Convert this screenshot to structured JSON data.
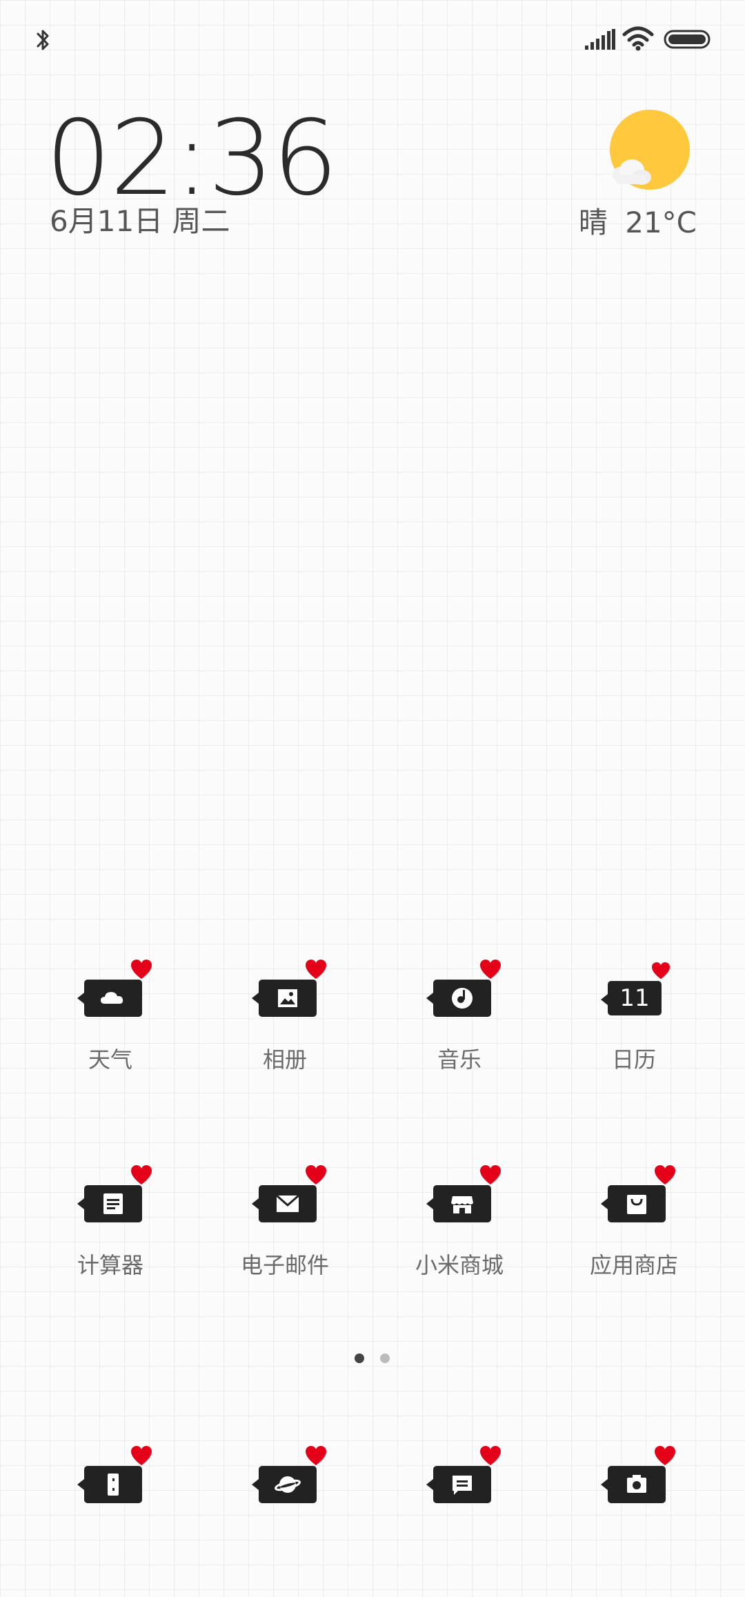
{
  "status_bar": {
    "bluetooth_icon": "bluetooth-icon",
    "signal_icon": "signal-icon",
    "wifi_icon": "wifi-icon",
    "battery_icon": "battery-icon"
  },
  "clock": {
    "time": "02:36",
    "date": "6月11日 周二"
  },
  "weather": {
    "condition": "晴",
    "temperature": "21°C",
    "icon": "sun-cloud-icon",
    "sun_color": "#FFC83D"
  },
  "apps": [
    {
      "label": "天气",
      "icon": "cloud-icon"
    },
    {
      "label": "相册",
      "icon": "image-icon"
    },
    {
      "label": "音乐",
      "icon": "music-disc-icon"
    },
    {
      "label": "日历",
      "icon": "calendar-icon",
      "icon_text": "11"
    },
    {
      "label": "计算器",
      "icon": "calculator-icon"
    },
    {
      "label": "电子邮件",
      "icon": "mail-icon"
    },
    {
      "label": "小米商城",
      "icon": "store-icon"
    },
    {
      "label": "应用商店",
      "icon": "shopping-bag-icon"
    }
  ],
  "page_indicator": {
    "total": 2,
    "active": 1,
    "active_color": "#444444",
    "inactive_color": "#BBBBBB"
  },
  "dock": [
    {
      "icon": "phone-icon"
    },
    {
      "icon": "browser-planet-icon"
    },
    {
      "icon": "message-icon"
    },
    {
      "icon": "camera-icon"
    }
  ],
  "colors": {
    "heart": "#E5001A",
    "icon_bg": "#222222"
  }
}
